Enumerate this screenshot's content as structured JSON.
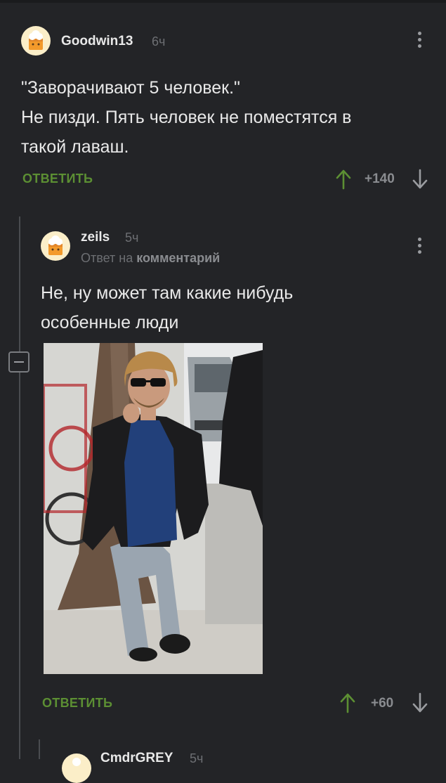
{
  "comment1": {
    "username": "Goodwin13",
    "time": "6ч",
    "text_lines": [
      "\"Заворачивают 5 человек.\"",
      "Не пизди. Пять человек не поместятся в",
      "такой лаваш."
    ],
    "reply_label": "ОТВЕТИТЬ",
    "score": "+140"
  },
  "comment2": {
    "username": "zeils",
    "time": "5ч",
    "reply_to_prefix": "Ответ на",
    "reply_to_link": "комментарий",
    "text_lines": [
      "Не, ну может там какие нибудь",
      "особенные люди"
    ],
    "reply_label": "ОТВЕТИТЬ",
    "score": "+60"
  },
  "comment3": {
    "username": "CmdrGREY",
    "time": "5ч"
  },
  "colors": {
    "background": "#232427",
    "accent_green": "#5c8f33",
    "muted_text": "#6d6f73"
  },
  "icons": [
    "avatar-chef-icon",
    "more-vertical-icon",
    "arrow-up-icon",
    "arrow-down-icon",
    "collapse-minus-icon"
  ]
}
